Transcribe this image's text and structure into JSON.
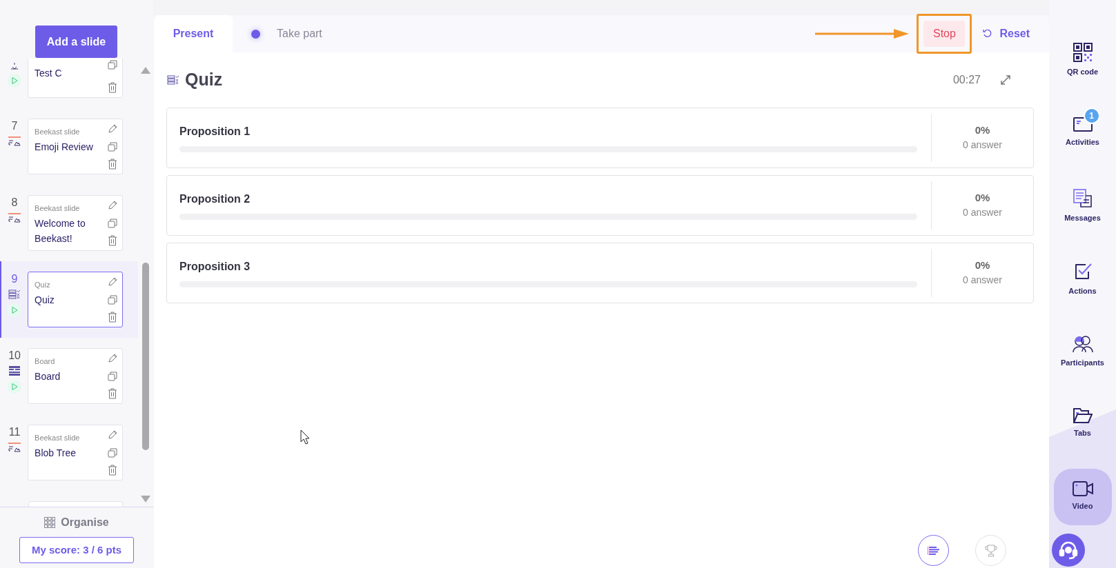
{
  "sidebar": {
    "add_button": "Add a slide",
    "slides": [
      {
        "title": "Test C",
        "kind": "test",
        "playable": true,
        "selected": false
      },
      {
        "number": "7",
        "type": "Beekast slide",
        "title": "Emoji Review",
        "kind": "slide",
        "playable": false,
        "selected": false
      },
      {
        "number": "8",
        "type": "Beekast slide",
        "title": "Welcome to Beekast!",
        "kind": "slide",
        "playable": false,
        "selected": false
      },
      {
        "number": "9",
        "type": "Quiz",
        "title": "Quiz",
        "kind": "quiz",
        "playable": true,
        "selected": true
      },
      {
        "number": "10",
        "type": "Board",
        "title": "Board",
        "kind": "board",
        "playable": true,
        "selected": false
      },
      {
        "number": "11",
        "type": "Beekast slide",
        "title": "Blob Tree",
        "kind": "slide",
        "playable": false,
        "selected": false
      },
      {
        "kind": "blank"
      }
    ],
    "organise": "Organise",
    "score": "My score: 3 / 6 pts"
  },
  "tabs": [
    {
      "label": "Present",
      "selected": true,
      "live": false
    },
    {
      "label": "Take part",
      "selected": false,
      "live": true
    }
  ],
  "actions": {
    "stop": "Stop",
    "reset": "Reset"
  },
  "activity": {
    "title": "Quiz",
    "timer": "00:27",
    "propositions": [
      {
        "label": "Proposition 1",
        "level": 0,
        "percent": "0%",
        "answers": "0 answer"
      },
      {
        "label": "Proposition 2",
        "level": 0,
        "percent": "0%",
        "answers": "0 answer"
      },
      {
        "label": "Proposition 3",
        "level": 0,
        "percent": "0%",
        "answers": "0 answer"
      }
    ]
  },
  "right_bar": [
    {
      "label": "QR code",
      "kind": "qr",
      "selected": false
    },
    {
      "label": "Activities",
      "kind": "activities",
      "badge": "1",
      "selected": false
    },
    {
      "label": "Messages",
      "kind": "messages",
      "selected": false
    },
    {
      "label": "Actions",
      "kind": "actions",
      "selected": false
    },
    {
      "label": "Participants",
      "kind": "participants",
      "selected": false
    },
    {
      "label": "Tabs",
      "kind": "tabs",
      "selected": false
    },
    {
      "label": "Video",
      "kind": "video",
      "selected": true
    }
  ]
}
